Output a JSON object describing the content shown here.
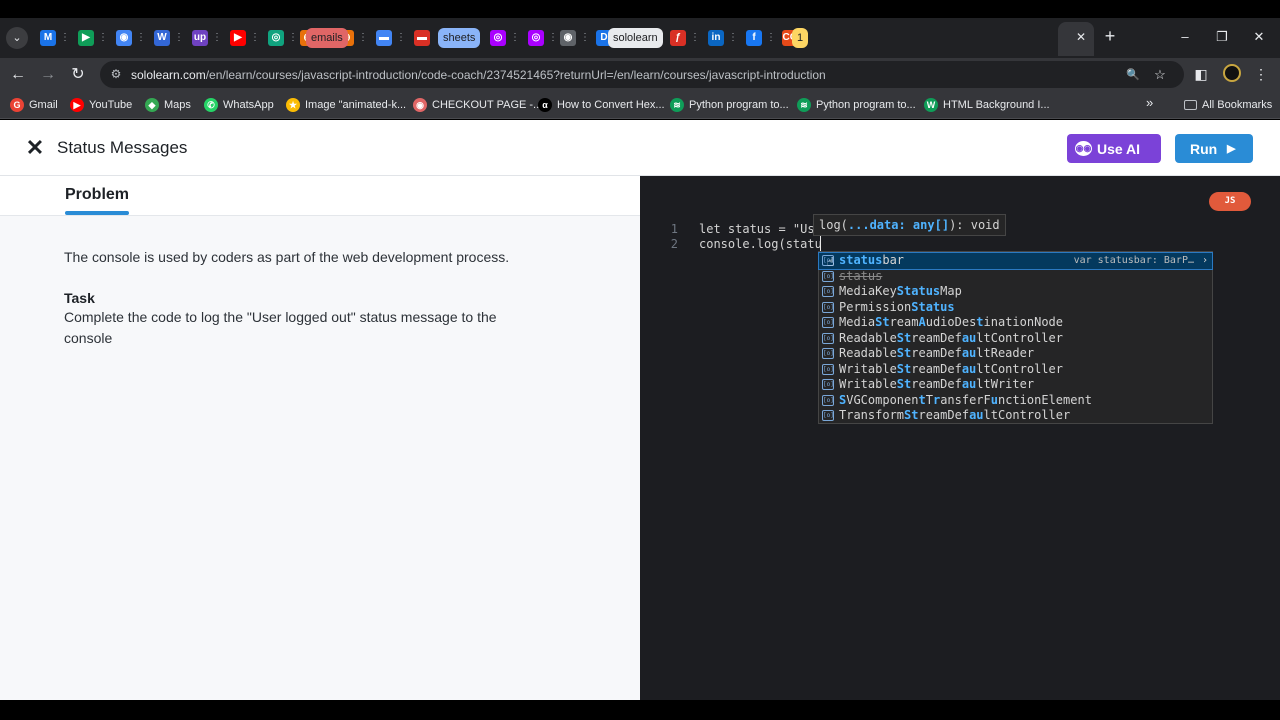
{
  "browser": {
    "tab_chips": {
      "emails": "emails",
      "sheets": "sheets",
      "sololearn": "sololearn",
      "badge": "1"
    },
    "tab_favicons": [
      "M",
      "▶",
      "◉",
      "W",
      "up",
      "▶",
      "◎",
      "◉",
      "◉",
      "▬",
      "▬",
      "△",
      "◎",
      "◎",
      "◉",
      "D",
      "▣",
      "ƒ",
      "in",
      "f",
      "CO"
    ],
    "tab_overflow": "⋮",
    "url_domain": "sololearn.com",
    "url_path": "/en/learn/courses/javascript-introduction/code-coach/2374521465?returnUrl=/en/learn/courses/javascript-introduction",
    "bookmarks": [
      "Gmail",
      "YouTube",
      "Maps",
      "WhatsApp",
      "Image \"animated-k...",
      "CHECKOUT PAGE -...",
      "How to Convert Hex...",
      "Python program to...",
      "Python program to...",
      "HTML Background I..."
    ],
    "bookmark_overflow": "»",
    "all_bookmarks": "All Bookmarks",
    "icons": {
      "search_tabs": "⌄",
      "back": "←",
      "forward": "→",
      "reload": "↻",
      "site_info": "⚙",
      "zoom": "🔍",
      "star": "☆",
      "sidepanel": "◧",
      "menu": "⋮",
      "minimize": "–",
      "restore": "❐",
      "close": "✕",
      "new_tab": "+",
      "folder": "▭"
    }
  },
  "app": {
    "close_icon": "✕",
    "title": "Status Messages",
    "use_ai_label": "Use AI",
    "run_label": "Run",
    "run_icon": "▶",
    "ai_icon": "◉◉"
  },
  "problem": {
    "tab_label": "Problem",
    "description": "The console is used by coders as part of the web development process.",
    "task_heading": "Task",
    "task_body": "Complete the code to log the \"User logged out\" status message to the console"
  },
  "editor": {
    "language_badge": "JS",
    "lines": [
      {
        "number": "1",
        "text": "let status = \"Us"
      },
      {
        "number": "2",
        "text": "console.log(statu"
      }
    ],
    "param_hint": {
      "prefix": "log(",
      "highlight": "...data: any[]",
      "suffix": "): void"
    },
    "suggestions": [
      {
        "match": "status",
        "rest": "bar",
        "detail": "var statusbar: BarP…",
        "arrow": "›",
        "selected": true
      },
      {
        "text": "status",
        "strike": true
      },
      {
        "html": "MediaKey<span class=\"m\">Status</span>Map"
      },
      {
        "html": "Permission<span class=\"m\">Status</span>"
      },
      {
        "html": "Media<span class=\"m\">St</span>ream<span class=\"m\">A</span>udioDes<span class=\"m\">t</span>inationNode"
      },
      {
        "html": "Readable<span class=\"m\">St</span>reamDef<span class=\"m\">au</span>ltController"
      },
      {
        "html": "Readable<span class=\"m\">St</span>reamDef<span class=\"m\">au</span>ltReader"
      },
      {
        "html": "Writable<span class=\"m\">St</span>reamDef<span class=\"m\">au</span>ltController"
      },
      {
        "html": "Writable<span class=\"m\">St</span>reamDef<span class=\"m\">au</span>ltWriter"
      },
      {
        "html": "<span class=\"m\">S</span>VGComponen<span class=\"m\">t</span>T<span class=\"m\">r</span>ansferF<span class=\"m\">u</span>nctionElement"
      },
      {
        "html": "Transform<span class=\"m\">St</span>reamDef<span class=\"m\">au</span>ltController"
      }
    ],
    "suggestion_plain": [
      "statusbar",
      "status",
      "MediaKeyStatusMap",
      "PermissionStatus",
      "MediaStreamAudioDestinationNode",
      "ReadableStreamDefaultController",
      "ReadableStreamDefaultReader",
      "WritableStreamDefaultController",
      "WritableStreamDefaultWriter",
      "SVGComponentTransferFunctionElement",
      "TransformStreamDefaultController"
    ],
    "suggestion_icon": "[o]",
    "pointer_icon": "☝"
  },
  "colors": {
    "use_ai": "#7b42d8",
    "run": "#2a8cd6",
    "js_badge": "#e15a3b",
    "editor_bg": "#1c1d21",
    "match_highlight": "#4fb3ff"
  }
}
